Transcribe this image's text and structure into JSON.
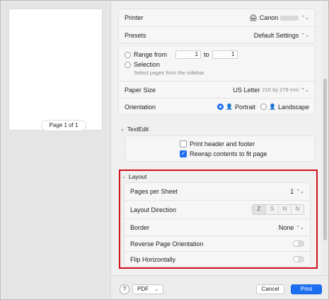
{
  "preview": {
    "page_label": "Page 1 of 1"
  },
  "printer": {
    "label": "Printer",
    "value": "Canon"
  },
  "presets": {
    "label": "Presets",
    "value": "Default Settings"
  },
  "pages": {
    "range_label": "Range from",
    "from": "1",
    "to_label": "to",
    "to": "1",
    "selection_label": "Selection",
    "selection_hint": "Select pages from the sidebar"
  },
  "paper_size": {
    "label": "Paper Size",
    "value": "US Letter",
    "dims": "216 by 279 mm"
  },
  "orientation": {
    "label": "Orientation",
    "portrait": "Portrait",
    "landscape": "Landscape"
  },
  "textedit": {
    "title": "TextEdit",
    "print_header": "Print header and footer",
    "rewrap": "Rewrap contents to fit page"
  },
  "layout": {
    "title": "Layout",
    "pages_per_sheet_label": "Pages per Sheet",
    "pages_per_sheet_value": "1",
    "direction_label": "Layout Direction",
    "directions": [
      "Z",
      "S",
      "N",
      "N"
    ],
    "border_label": "Border",
    "border_value": "None",
    "reverse_label": "Reverse Page Orientation",
    "flip_label": "Flip Horizontally"
  },
  "footer": {
    "help": "?",
    "pdf": "PDF",
    "cancel": "Cancel",
    "print": "Print"
  },
  "colors": {
    "accent": "#1d6ff2",
    "highlight": "#d0101a"
  }
}
